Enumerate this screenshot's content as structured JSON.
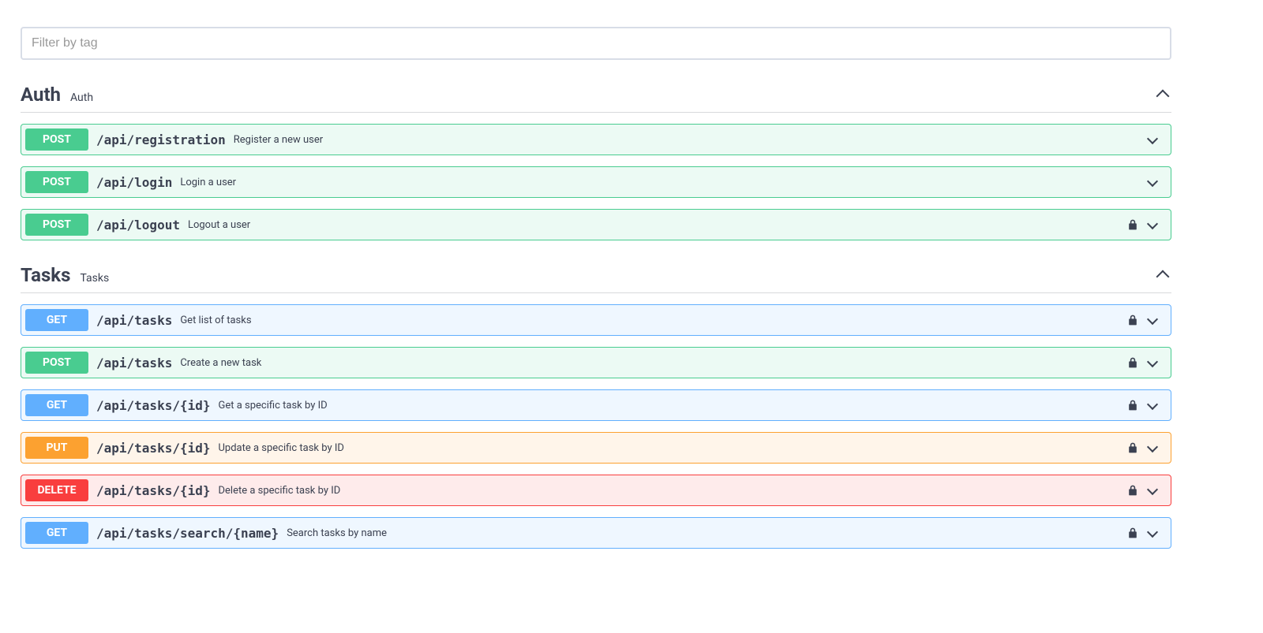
{
  "filter": {
    "placeholder": "Filter by tag"
  },
  "sections": [
    {
      "name": "Auth",
      "description": "Auth",
      "ops": [
        {
          "method": "POST",
          "path": "/api/registration",
          "desc": "Register a new user",
          "locked": false
        },
        {
          "method": "POST",
          "path": "/api/login",
          "desc": "Login a user",
          "locked": false
        },
        {
          "method": "POST",
          "path": "/api/logout",
          "desc": "Logout a user",
          "locked": true
        }
      ]
    },
    {
      "name": "Tasks",
      "description": "Tasks",
      "ops": [
        {
          "method": "GET",
          "path": "/api/tasks",
          "desc": "Get list of tasks",
          "locked": true
        },
        {
          "method": "POST",
          "path": "/api/tasks",
          "desc": "Create a new task",
          "locked": true
        },
        {
          "method": "GET",
          "path": "/api/tasks/{id}",
          "desc": "Get a specific task by ID",
          "locked": true
        },
        {
          "method": "PUT",
          "path": "/api/tasks/{id}",
          "desc": "Update a specific task by ID",
          "locked": true
        },
        {
          "method": "DELETE",
          "path": "/api/tasks/{id}",
          "desc": "Delete a specific task by ID",
          "locked": true
        },
        {
          "method": "GET",
          "path": "/api/tasks/search/{name}",
          "desc": "Search tasks by name",
          "locked": true
        }
      ]
    }
  ]
}
